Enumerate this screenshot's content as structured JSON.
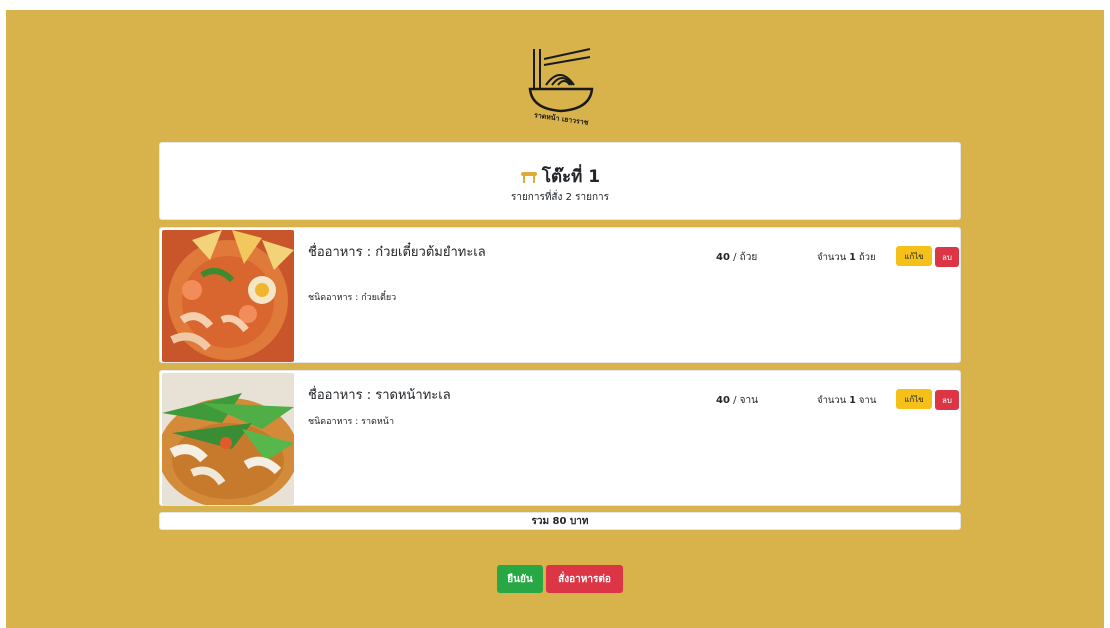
{
  "colors": {
    "background": "#d8b24a",
    "card": "#ffffff",
    "edit_button": "#f5c018",
    "delete_button": "#dc3545",
    "confirm_button": "#28a745",
    "order_more_button": "#dc3545"
  },
  "logo": {
    "icon": "noodle-bowl-logo-icon",
    "text": "ราดหน้า เยาวราช"
  },
  "header": {
    "icon": "table-icon",
    "title": "โต๊ะที่ 1",
    "subtitle": "รายการที่สั่ง 2 รายการ"
  },
  "items": [
    {
      "name": "ชื่ออาหาร : ก๋วยเตี๋ยวต้มยำทะเล",
      "type": "ชนิดอาหาร : ก๋วยเตี๋ยว",
      "price_value": "40",
      "price_unit": "/ ถ้วย",
      "qty_prefix": "จำนวน",
      "qty_value": "1",
      "qty_unit": "ถ้วย",
      "edit_label": "แก้ไข",
      "delete_label": "ลบ"
    },
    {
      "name": "ชื่ออาหาร : ราดหน้าทะเล",
      "type": "ชนิดอาหาร : ราดหน้า",
      "price_value": "40",
      "price_unit": "/ จาน",
      "qty_prefix": "จำนวน",
      "qty_value": "1",
      "qty_unit": "จาน",
      "edit_label": "แก้ไข",
      "delete_label": "ลบ"
    }
  ],
  "total": "รวม 80 บาท",
  "actions": {
    "confirm_label": "ยืนยัน",
    "order_more_label": "สั่งอาหารต่อ"
  }
}
